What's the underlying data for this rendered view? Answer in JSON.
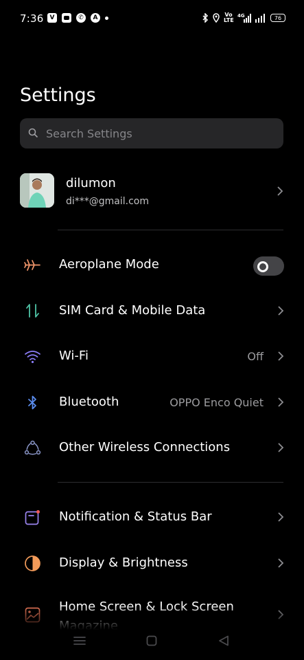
{
  "status_bar": {
    "time": "7:36",
    "notifications": [
      "v-app-icon",
      "chat-icon",
      "whatsapp-icon",
      "a-app-icon"
    ],
    "volte_label": "Vo LTE",
    "network_label": "4G",
    "battery": "76"
  },
  "title": "Settings",
  "search": {
    "placeholder": "Search Settings"
  },
  "account": {
    "name": "dilumon",
    "email": "di***@gmail.com"
  },
  "items": [
    {
      "label": "Aeroplane Mode",
      "icon": "airplane-icon",
      "icon_color": "#f0956a",
      "toggle": false
    },
    {
      "label": "SIM Card & Mobile Data",
      "icon": "sim-data-icon",
      "icon_color": "#4fc3a6"
    },
    {
      "label": "Wi-Fi",
      "value": "Off",
      "icon": "wifi-icon",
      "icon_color": "#8a7cf5"
    },
    {
      "label": "Bluetooth",
      "value": "OPPO Enco Quiet",
      "icon": "bluetooth-icon",
      "icon_color": "#5b8def"
    },
    {
      "label": "Other Wireless Connections",
      "icon": "wireless-connections-icon",
      "icon_color": "#8a96c8"
    },
    {
      "label": "Notification & Status Bar",
      "icon": "notification-icon",
      "icon_color": "#9b85f0"
    },
    {
      "label": "Display & Brightness",
      "icon": "display-brightness-icon",
      "icon_color": "#f29b5a"
    },
    {
      "label": "Home Screen & Lock Screen Magazine",
      "icon": "home-screen-icon",
      "icon_color": "#f07a5a"
    }
  ],
  "nav_bar": [
    "menu-icon",
    "home-icon",
    "back-icon"
  ]
}
